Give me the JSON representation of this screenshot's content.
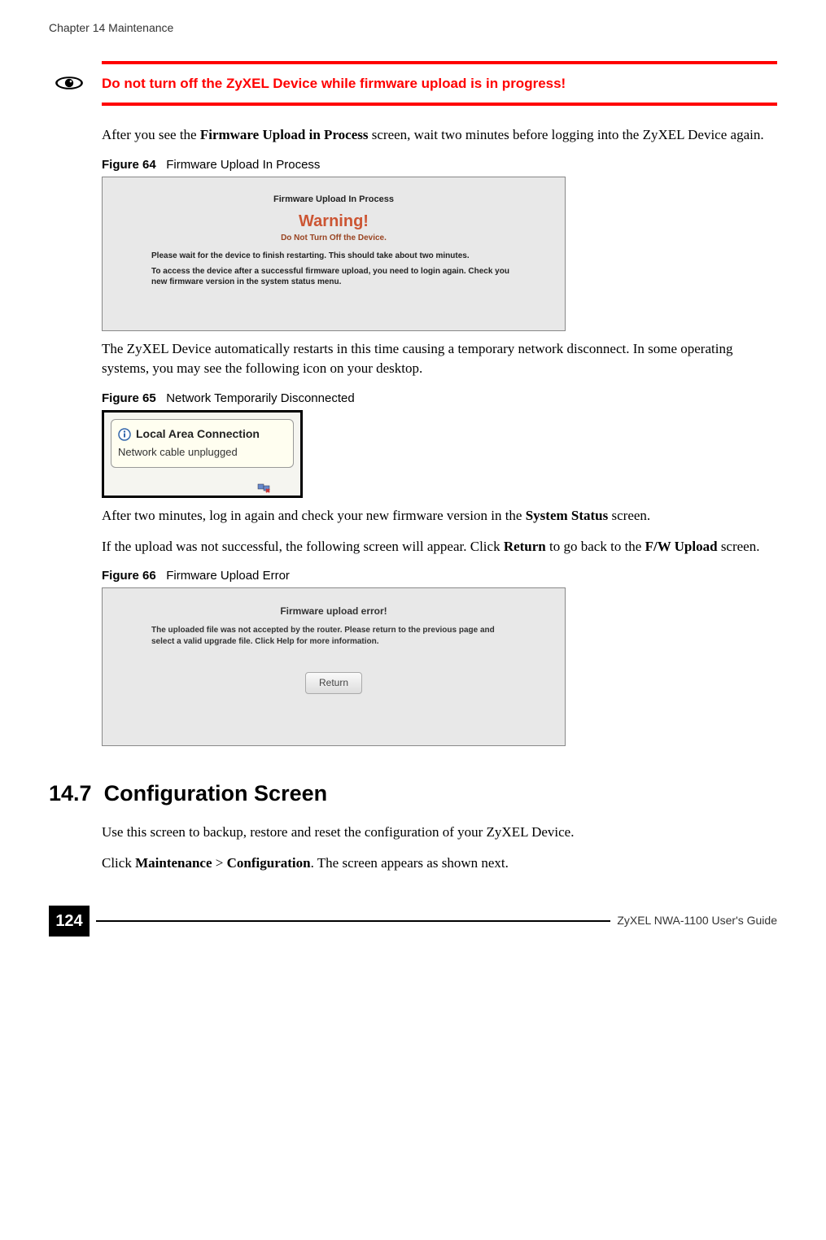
{
  "header": "Chapter 14 Maintenance",
  "alerts": {
    "important": "Do not turn off the ZyXEL Device while firmware upload is in progress!"
  },
  "paragraphs": {
    "p1a": "After you see the ",
    "p1b": "Firmware Upload in Process",
    "p1c": " screen, wait two minutes before logging into the ZyXEL Device again.",
    "p2": "The ZyXEL Device automatically restarts in this time causing a temporary network disconnect. In some operating systems, you may see the following icon on your desktop.",
    "p3a": "After two minutes, log in again and check your new firmware version in the ",
    "p3b": "System Status",
    "p3c": " screen.",
    "p4a": "If the upload was not successful, the following screen will appear. Click ",
    "p4b": "Return",
    "p4c": " to go back to the ",
    "p4d": "F/W Upload",
    "p4e": " screen.",
    "p5": "Use this screen to backup, restore and reset the configuration of your ZyXEL Device.",
    "p6a": "Click ",
    "p6b": "Maintenance",
    "p6c": " > ",
    "p6d": "Configuration",
    "p6e": ". The screen appears as shown next."
  },
  "figures": {
    "f64": {
      "num": "Figure 64",
      "caption": "Firmware Upload In Process",
      "inner": {
        "title": "Firmware Upload In Process",
        "warning": "Warning!",
        "dont": "Do Not Turn Off the Device.",
        "msg1": "Please wait for the device to finish restarting. This should take about two minutes.",
        "msg2": "To access the device after a successful firmware upload, you need to login again. Check you new firmware version in the system status menu."
      }
    },
    "f65": {
      "num": "Figure 65",
      "caption": "Network Temporarily Disconnected",
      "inner": {
        "title": "Local Area Connection",
        "msg": "Network cable unplugged"
      }
    },
    "f66": {
      "num": "Figure 66",
      "caption": "Firmware Upload Error",
      "inner": {
        "title": "Firmware upload error!",
        "msg": "The uploaded file was not accepted by the router. Please return to the previous page and select a valid upgrade file. Click Help for more information.",
        "button": "Return"
      }
    }
  },
  "section": {
    "number": "14.7",
    "title": "Configuration Screen"
  },
  "footer": {
    "page": "124",
    "guide": "ZyXEL NWA-1100 User's Guide"
  }
}
